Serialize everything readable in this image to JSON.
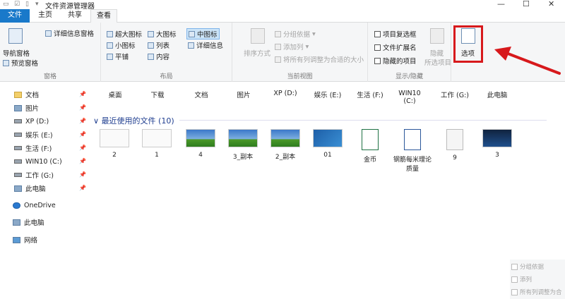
{
  "window": {
    "title": "文件资源管理器",
    "controls": {
      "minimize": "—",
      "maximize": "☐",
      "close": "✕"
    }
  },
  "tabs": {
    "file": "文件",
    "home": "主页",
    "share": "共享",
    "view": "查看"
  },
  "ribbon": {
    "panes": {
      "label": "窗格",
      "nav_pane": "导航窗格",
      "preview_pane": "预览窗格",
      "details_pane": "详细信息窗格"
    },
    "layout": {
      "label": "布局",
      "items": [
        "超大图标",
        "大图标",
        "中图标",
        "小图标",
        "列表",
        "详细信息",
        "平铺",
        "内容"
      ],
      "selected": "中图标"
    },
    "current_view": {
      "label": "当前视图",
      "sort_by": "排序方式",
      "group_by": "分组依据",
      "add_column": "添加列",
      "fit_columns": "将所有列调整为合适的大小"
    },
    "show_hide": {
      "label": "显示/隐藏",
      "item_checkboxes": "项目复选框",
      "file_extensions": "文件扩展名",
      "hidden_items": "隐藏的项目",
      "hide_selected_1": "隐藏",
      "hide_selected_2": "所选项目"
    },
    "options": {
      "label": "选项"
    }
  },
  "nav_pane": {
    "items": [
      {
        "label": "文档",
        "icon": "documents-icon",
        "pinned": true
      },
      {
        "label": "图片",
        "icon": "pictures-icon",
        "pinned": true
      },
      {
        "label": "XP (D:)",
        "icon": "drive-icon",
        "pinned": true
      },
      {
        "label": "娱乐 (E:)",
        "icon": "drive-icon",
        "pinned": true
      },
      {
        "label": "生活 (F:)",
        "icon": "drive-icon",
        "pinned": true
      },
      {
        "label": "WIN10 (C:)",
        "icon": "drive-icon",
        "pinned": true
      },
      {
        "label": "工作 (G:)",
        "icon": "drive-icon",
        "pinned": true
      },
      {
        "label": "此电脑",
        "icon": "computer-icon",
        "pinned": true
      }
    ],
    "onedrive": "OneDrive",
    "this_pc": "此电脑",
    "network": "网络",
    "pin_glyph": "📌"
  },
  "content": {
    "pinned_items": [
      "桌面",
      "下载",
      "文档",
      "图片",
      "XP (D:)",
      "娱乐 (E:)",
      "生活 (F:)",
      "WIN10 (C:)",
      "工作 (G:)",
      "此电脑"
    ],
    "recent_header": "最近使用的文件 (10)",
    "recent_files": [
      {
        "name": "2",
        "thumb": "white"
      },
      {
        "name": "1",
        "thumb": "white"
      },
      {
        "name": "4",
        "thumb": "grass"
      },
      {
        "name": "3_副本",
        "thumb": "grass"
      },
      {
        "name": "2_副本",
        "thumb": "grass"
      },
      {
        "name": "01",
        "thumb": "win7"
      },
      {
        "name": "金币",
        "thumb": "excel"
      },
      {
        "name": "钢筋每米理论质量",
        "thumb": "word"
      },
      {
        "name": "9",
        "thumb": "doc"
      },
      {
        "name": "3",
        "thumb": "dark"
      }
    ]
  },
  "overlay": {
    "group_by": "分组依据",
    "add_column": "添列",
    "fit_columns": "所有列调整为合"
  },
  "annotation": {
    "color": "#d7191c"
  }
}
